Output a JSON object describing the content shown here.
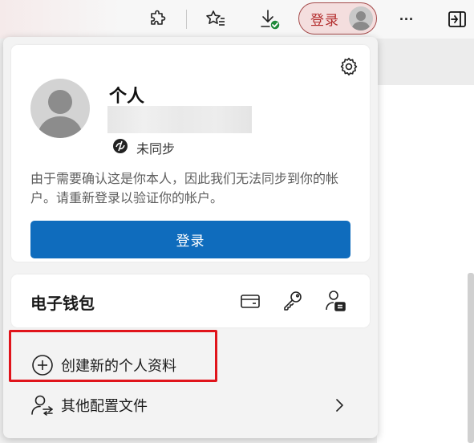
{
  "toolbar": {
    "icons": [
      "extensions-icon",
      "favorites-icon",
      "downloads-icon",
      "more-icon",
      "sidebar-toggle-icon"
    ],
    "signin_label": "登录",
    "more_glyph": "···"
  },
  "profile": {
    "name": "个人",
    "sync_status": "未同步",
    "sync_message": "由于需要确认这是你本人，因此我们无法同步到你的帐户。请重新登录以验证你的帐户。",
    "signin_button": "登录"
  },
  "wallet": {
    "title": "电子钱包",
    "icons": [
      "payment-card-icon",
      "password-key-icon",
      "personal-info-icon"
    ]
  },
  "menu": {
    "create_profile": "创建新的个人资料",
    "other_profiles": "其他配置文件"
  },
  "colors": {
    "accent": "#0f6cbd",
    "signin_pill_border": "#a44a4a",
    "signin_pill_text": "#b32d2d",
    "highlight": "#e0141b"
  }
}
